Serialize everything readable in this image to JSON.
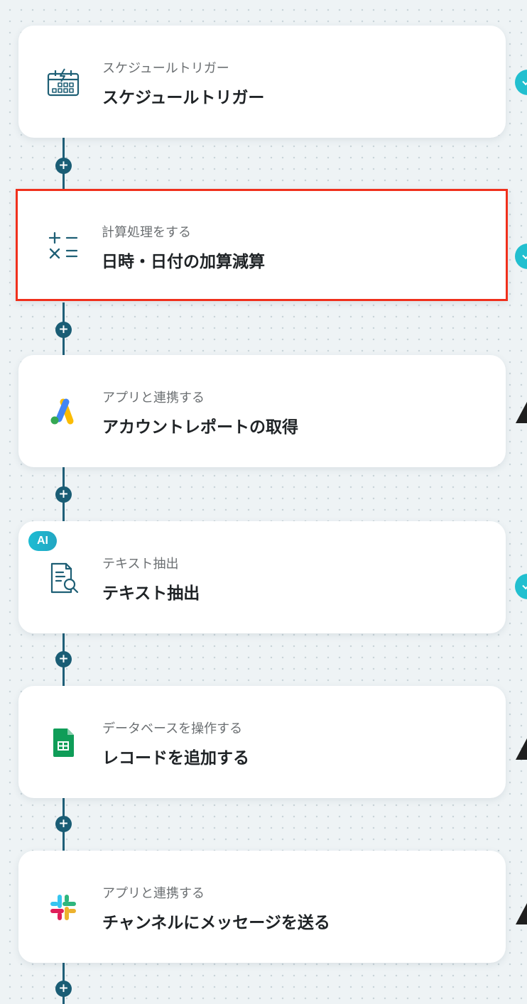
{
  "flow": {
    "steps": [
      {
        "category": "スケジュールトリガー",
        "title": "スケジュールトリガー",
        "icon": "schedule-trigger-icon",
        "status": "check"
      },
      {
        "category": "計算処理をする",
        "title": "日時・日付の加算減算",
        "icon": "calculator-icon",
        "status": "check",
        "selected": true
      },
      {
        "category": "アプリと連携する",
        "title": "アカウントレポートの取得",
        "icon": "google-ads-icon",
        "status": "warning"
      },
      {
        "category": "テキスト抽出",
        "title": "テキスト抽出",
        "icon": "text-extract-icon",
        "status": "check",
        "badge": "AI"
      },
      {
        "category": "データベースを操作する",
        "title": "レコードを追加する",
        "icon": "google-sheets-icon",
        "status": "warning"
      },
      {
        "category": "アプリと連携する",
        "title": "チャンネルにメッセージを送る",
        "icon": "slack-icon",
        "status": "warning"
      }
    ],
    "add_step_symbol": "+"
  },
  "colors": {
    "connector": "#1f5f78",
    "selection_border": "#f0301c",
    "status_check": "#22bfcf",
    "status_warning": "#1f1f1f"
  }
}
